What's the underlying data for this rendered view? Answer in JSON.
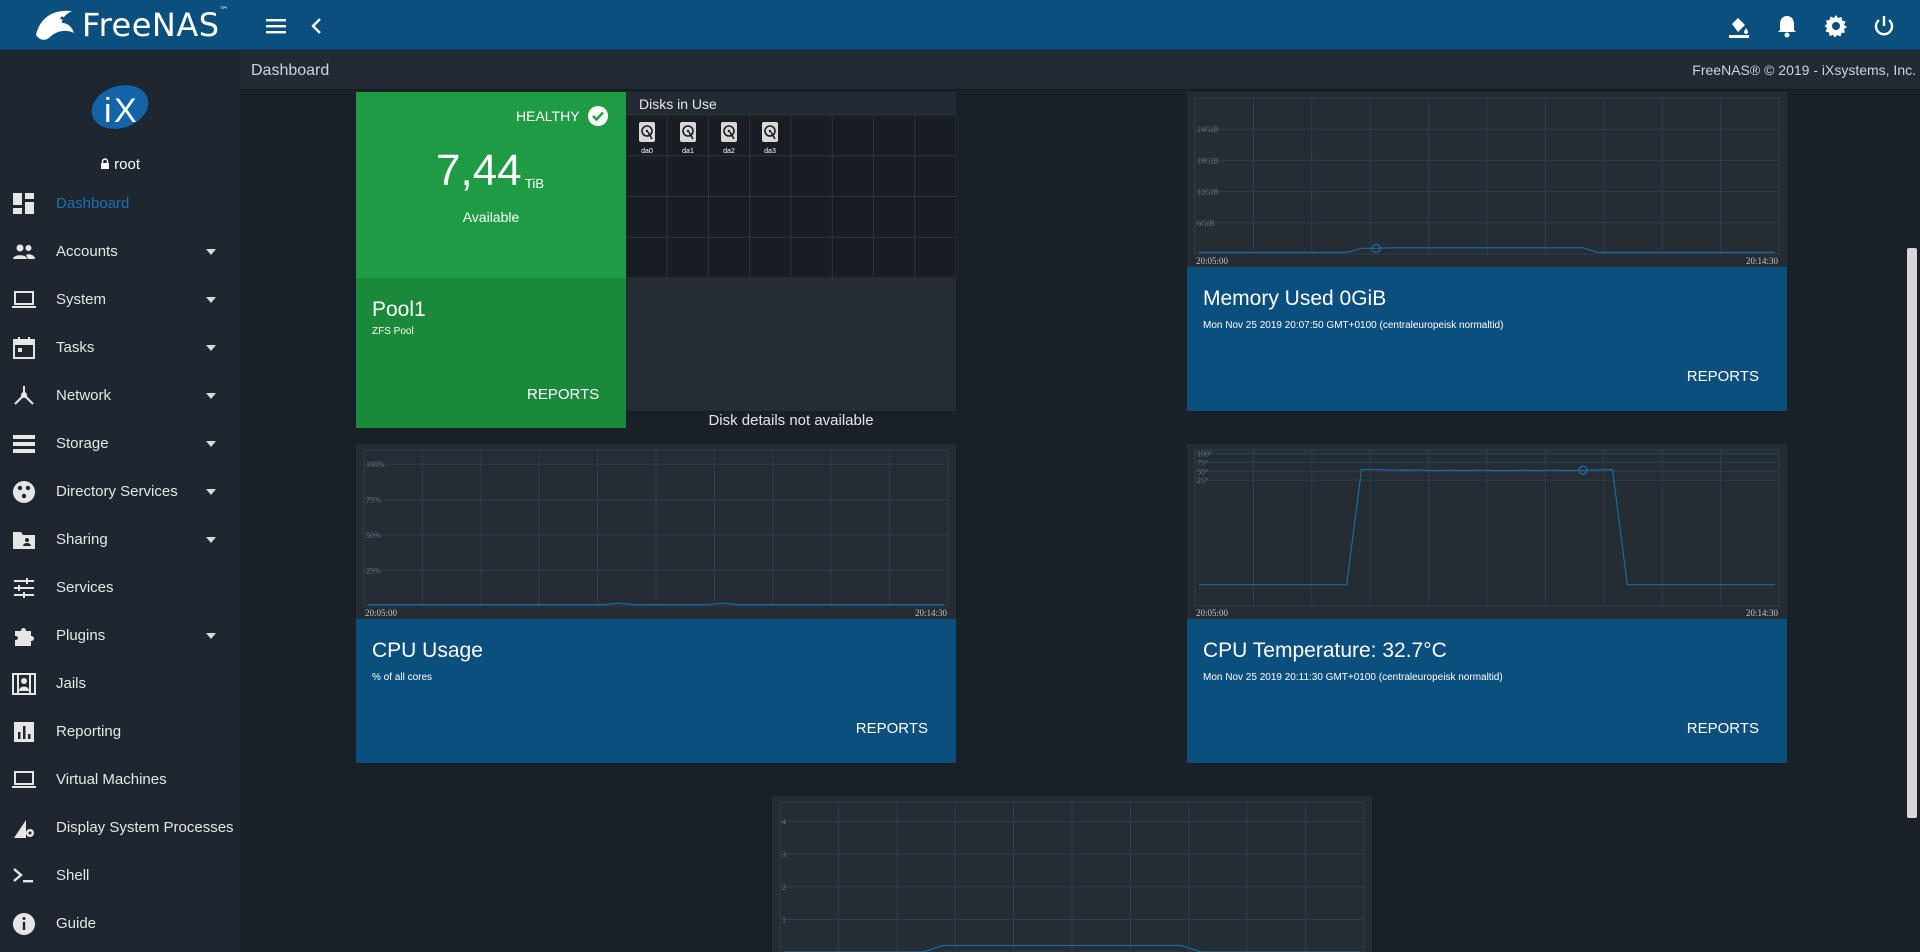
{
  "app": {
    "logo_text": "FreeNAS",
    "logo_mark": "™"
  },
  "user": {
    "name": "root"
  },
  "page": {
    "title": "Dashboard",
    "copyright": "FreeNAS® © 2019 - iXsystems, Inc."
  },
  "sidebar": {
    "items": [
      {
        "label": "Dashboard",
        "icon": "dashboard-icon",
        "active": true,
        "has_submenu": false
      },
      {
        "label": "Accounts",
        "icon": "people-icon",
        "active": false,
        "has_submenu": true
      },
      {
        "label": "System",
        "icon": "laptop-icon",
        "active": false,
        "has_submenu": true
      },
      {
        "label": "Tasks",
        "icon": "calendar-icon",
        "active": false,
        "has_submenu": true
      },
      {
        "label": "Network",
        "icon": "network-icon",
        "active": false,
        "has_submenu": true
      },
      {
        "label": "Storage",
        "icon": "storage-icon",
        "active": false,
        "has_submenu": true
      },
      {
        "label": "Directory Services",
        "icon": "directory-icon",
        "active": false,
        "has_submenu": true
      },
      {
        "label": "Sharing",
        "icon": "folder-share-icon",
        "active": false,
        "has_submenu": true
      },
      {
        "label": "Services",
        "icon": "tune-icon",
        "active": false,
        "has_submenu": false
      },
      {
        "label": "Plugins",
        "icon": "puzzle-icon",
        "active": false,
        "has_submenu": true
      },
      {
        "label": "Jails",
        "icon": "jail-icon",
        "active": false,
        "has_submenu": false
      },
      {
        "label": "Reporting",
        "icon": "bar-chart-icon",
        "active": false,
        "has_submenu": false
      },
      {
        "label": "Virtual Machines",
        "icon": "computer-icon",
        "active": false,
        "has_submenu": false
      },
      {
        "label": "Display System Processes",
        "icon": "processes-icon",
        "active": false,
        "has_submenu": false
      },
      {
        "label": "Shell",
        "icon": "shell-icon",
        "active": false,
        "has_submenu": false
      },
      {
        "label": "Guide",
        "icon": "info-icon",
        "active": false,
        "has_submenu": false
      }
    ]
  },
  "pool": {
    "status": "HEALTHY",
    "available_value": "7,44",
    "available_unit": "TiB",
    "available_label": "Available",
    "name": "Pool1",
    "type": "ZFS Pool",
    "reports_label": "REPORTS",
    "disks_title": "Disks in Use",
    "disks": [
      "da0",
      "da1",
      "da2",
      "da3"
    ],
    "disk_details": "Disk details not available"
  },
  "memory": {
    "title": "Memory Used 0GiB",
    "subtitle": "Mon Nov 25 2019 20:07:50 GMT+0100 (centraleuropeisk normaltid)",
    "reports_label": "REPORTS"
  },
  "cpu": {
    "title": "CPU Usage",
    "subtitle": "% of all cores",
    "reports_label": "REPORTS"
  },
  "temp": {
    "title": "CPU Temperature: 32.7°C",
    "subtitle": "Mon Nov 25 2019 20:11:30 GMT+0100 (centraleuropeisk normaltid)",
    "reports_label": "REPORTS"
  },
  "colors": {
    "topbar": "#0b4f7e",
    "sidebar": "#1e2730",
    "background": "#1a2027",
    "card": "#242c34",
    "healthy_green": "#1f9b43",
    "active_nav": "#1e6fb0",
    "series_line": "#1b6aa5"
  },
  "chart_data": [
    {
      "type": "line",
      "name": "memory",
      "x_labels": [
        "20:05:00",
        "20:14:30"
      ],
      "y_ticks": [
        "6GiB",
        "12GiB",
        "18GiB",
        "24GiB"
      ],
      "y_values": [
        6,
        12,
        18,
        24
      ],
      "series": [
        {
          "values": [
            0.3,
            0.3,
            0.3,
            0.3,
            0.3,
            0.3,
            0.3,
            0.3,
            0.3,
            0.3,
            0.3,
            1.1,
            1.1,
            1.2,
            1.2,
            1.2,
            1.2,
            1.2,
            1.2,
            1.2,
            1.2,
            1.2,
            1.2,
            1.2,
            1.2,
            1.2,
            1.2,
            0.3,
            0.3,
            0.3,
            0.3,
            0.3,
            0.3,
            0.3,
            0.3,
            0.3,
            0.3,
            0.3,
            0.3,
            0.3
          ]
        }
      ],
      "ylim": [
        0,
        30
      ]
    },
    {
      "type": "line",
      "name": "cpu",
      "x_labels": [
        "20:05:00",
        "20:14:30"
      ],
      "y_ticks": [
        "25%",
        "50%",
        "75%",
        "100%"
      ],
      "y_values": [
        25,
        50,
        75,
        100
      ],
      "series": [
        {
          "values": [
            1,
            1,
            1,
            1,
            1,
            1,
            1,
            1,
            1,
            1,
            1,
            1,
            1,
            1,
            1,
            1,
            1,
            2,
            1,
            1,
            1,
            1,
            1,
            1,
            2,
            1,
            1,
            1,
            1,
            1,
            1,
            1,
            1,
            1,
            1,
            1,
            1,
            1,
            1,
            1
          ]
        }
      ],
      "ylim": [
        0,
        110
      ]
    },
    {
      "type": "line",
      "name": "temperature",
      "x_labels": [
        "20:05:00",
        "20:14:30"
      ],
      "y_ticks": [
        "25°",
        "50°",
        "75°",
        "100°"
      ],
      "y_values": [
        25,
        50,
        75,
        100
      ],
      "series": [
        {
          "values": [
            -270,
            -270,
            -270,
            -270,
            -270,
            -270,
            -270,
            -270,
            -270,
            -270,
            -270,
            55,
            55,
            53,
            54,
            53,
            52,
            53,
            52,
            53,
            52,
            52,
            53,
            52,
            53,
            52,
            53,
            54,
            55,
            -270,
            -270,
            -270,
            -270,
            -270,
            -270,
            -270,
            -270,
            -270,
            -270,
            -270
          ]
        }
      ],
      "ylim": [
        -330,
        110
      ]
    },
    {
      "type": "line",
      "name": "load",
      "y_ticks": [
        "1",
        "2",
        "3",
        "4"
      ],
      "y_values": [
        1,
        2,
        3,
        4
      ],
      "series": [
        {
          "values": [
            0,
            0,
            0,
            0,
            0,
            0,
            0,
            0,
            0.2,
            0.2,
            0.2,
            0.2,
            0.2,
            0.2,
            0.2,
            0.2,
            0.2,
            0.2,
            0.2,
            0.2,
            0.2,
            0,
            0,
            0,
            0,
            0,
            0,
            0,
            0,
            0
          ]
        }
      ],
      "ylim": [
        0,
        4.6
      ]
    }
  ]
}
